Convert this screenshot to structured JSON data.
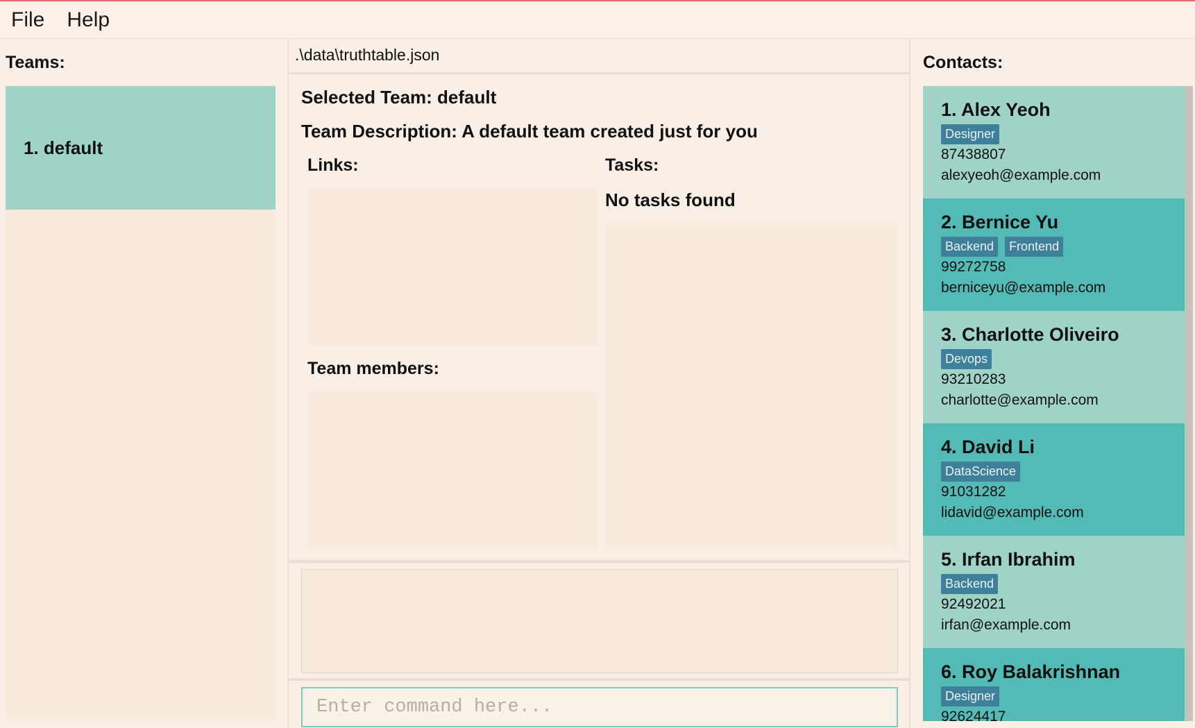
{
  "menu": {
    "file": "File",
    "help": "Help"
  },
  "teams": {
    "title": "Teams:",
    "items": [
      {
        "label": "1. default"
      }
    ]
  },
  "main": {
    "file_path": ".\\data\\truthtable.json",
    "selected_team": "Selected Team: default",
    "team_description": "Team Description: A default team created just for you",
    "links_title": "Links:",
    "tasks_title": "Tasks:",
    "no_tasks": "No tasks found",
    "members_title": "Team members:",
    "command_placeholder": "Enter command here..."
  },
  "contacts": {
    "title": "Contacts:",
    "items": [
      {
        "name": "1. Alex Yeoh",
        "tags": [
          "Designer"
        ],
        "phone": "87438807",
        "email": "alexyeoh@example.com"
      },
      {
        "name": "2. Bernice Yu",
        "tags": [
          "Backend",
          "Frontend"
        ],
        "phone": "99272758",
        "email": "berniceyu@example.com"
      },
      {
        "name": "3. Charlotte Oliveiro",
        "tags": [
          "Devops"
        ],
        "phone": "93210283",
        "email": "charlotte@example.com"
      },
      {
        "name": "4. David Li",
        "tags": [
          "DataScience"
        ],
        "phone": "91031282",
        "email": "lidavid@example.com"
      },
      {
        "name": "5. Irfan Ibrahim",
        "tags": [
          "Backend"
        ],
        "phone": "92492021",
        "email": "irfan@example.com"
      },
      {
        "name": "6. Roy Balakrishnan",
        "tags": [
          "Designer"
        ],
        "phone": "92624417",
        "email": ""
      }
    ]
  },
  "colors": {
    "background": "#f9efe6",
    "team_card": "#9fd3c7",
    "contact_light": "#9fd3c7",
    "contact_dark": "#54bab6",
    "tag": "#3e7f9a",
    "command_border": "#7fc9c0",
    "title_bar_accent": "#e36b6b"
  }
}
